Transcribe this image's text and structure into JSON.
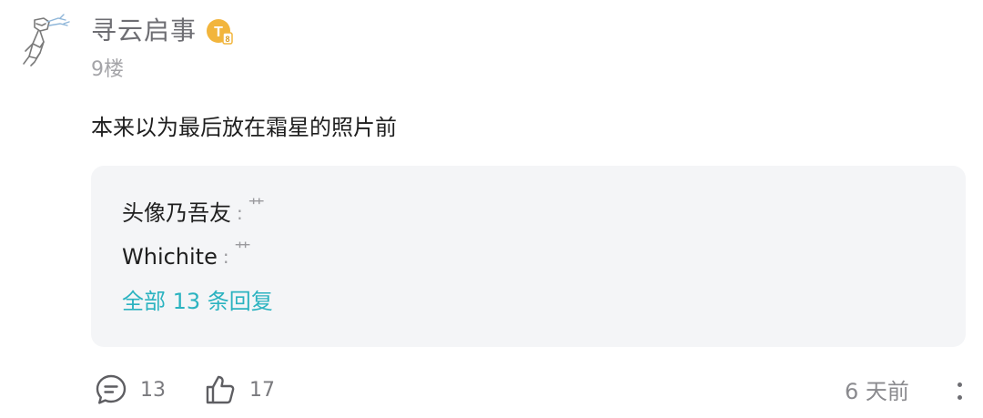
{
  "post": {
    "username": "寻云启事",
    "level_badge_letter": "T",
    "level_badge_number": "8",
    "floor": "9楼",
    "content": "本来以为最后放在霜星的照片前",
    "replies": [
      {
        "author": "头像乃吾友",
        "separator": ":",
        "text": "艹"
      },
      {
        "author": "Whichite",
        "separator": ":",
        "text": "艹"
      }
    ],
    "view_all_label": "全部 13 条回复",
    "comment_count": "13",
    "like_count": "17",
    "time": "6 天前"
  },
  "colors": {
    "accent": "#2bb3c0",
    "badge": "#f2b53c",
    "reply_bg": "#f4f5f7"
  },
  "icons": {
    "avatar": "avatar-sketch",
    "level_badge": "level-badge-icon",
    "comment": "comment-icon",
    "like": "thumbs-up-icon",
    "more": "more-vertical-icon"
  }
}
